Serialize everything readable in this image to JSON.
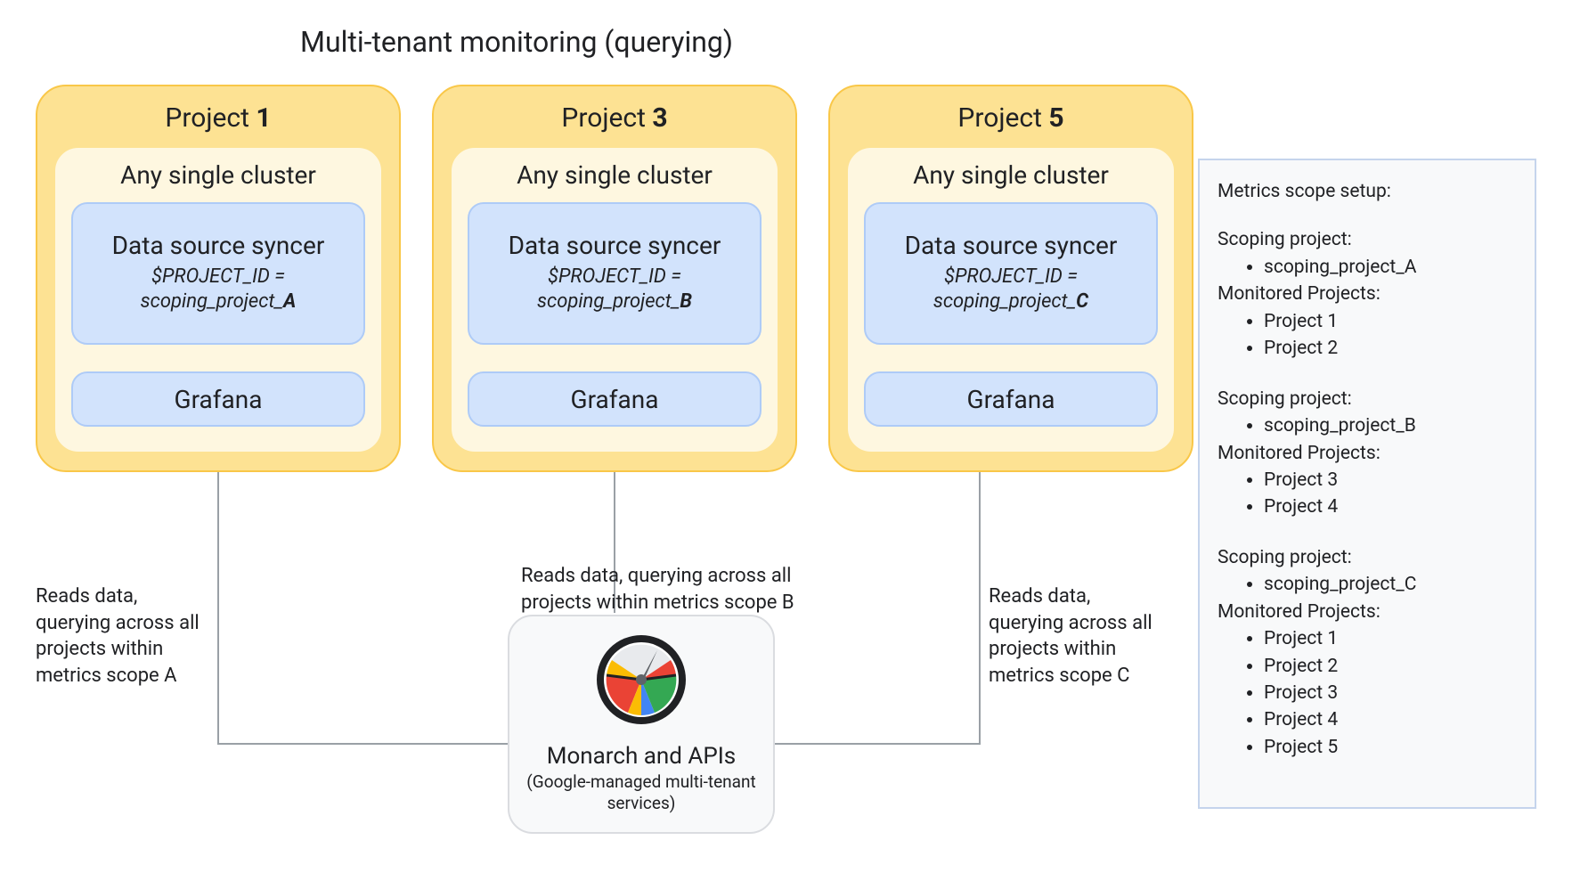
{
  "title": "Multi-tenant monitoring (querying)",
  "projects": [
    {
      "title_prefix": "Project ",
      "title_bold": "1",
      "cluster_label": "Any single cluster",
      "syncer_line1": "Data source syncer",
      "syncer_line2_prefix": "$PROJECT_ID = scoping_project_",
      "syncer_line2_bold": "A",
      "grafana_label": "Grafana"
    },
    {
      "title_prefix": "Project ",
      "title_bold": "3",
      "cluster_label": "Any single cluster",
      "syncer_line1": "Data source syncer",
      "syncer_line2_prefix": "$PROJECT_ID = scoping_project_",
      "syncer_line2_bold": "B",
      "grafana_label": "Grafana"
    },
    {
      "title_prefix": "Project ",
      "title_bold": "5",
      "cluster_label": "Any single cluster",
      "syncer_line1": "Data source syncer",
      "syncer_line2_prefix": "$PROJECT_ID = scoping_project_",
      "syncer_line2_bold": "C",
      "grafana_label": "Grafana"
    }
  ],
  "captions": {
    "a": "Reads data, querying across all projects within metrics scope A",
    "b": "Reads data, querying across all projects within metrics scope B",
    "c": "Reads data, querying across all projects within metrics scope C"
  },
  "monarch": {
    "title": "Monarch and APIs",
    "subtitle": "(Google-managed multi-tenant services)"
  },
  "sidebar": {
    "heading": "Metrics scope setup:",
    "groups": [
      {
        "scoping_label": "Scoping project:",
        "scoping_items": [
          "scoping_project_A"
        ],
        "monitored_label": "Monitored Projects:",
        "monitored_items": [
          "Project 1",
          "Project 2"
        ]
      },
      {
        "scoping_label": "Scoping project:",
        "scoping_items": [
          "scoping_project_B"
        ],
        "monitored_label": "Monitored Projects:",
        "monitored_items": [
          "Project 3",
          "Project 4"
        ]
      },
      {
        "scoping_label": "Scoping project:",
        "scoping_items": [
          "scoping_project_C"
        ],
        "monitored_label": "Monitored Projects:",
        "monitored_items": [
          "Project 1",
          "Project 2",
          "Project 3",
          "Project 4",
          "Project 5"
        ]
      }
    ]
  }
}
